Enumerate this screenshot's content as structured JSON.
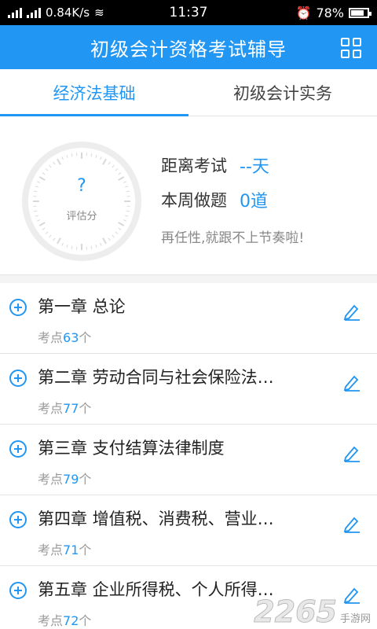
{
  "status_bar": {
    "network_speed": "0.84K/s",
    "time": "11:37",
    "battery": "78%",
    "battery_level": 0.78
  },
  "header": {
    "title": "初级会计资格考试辅导",
    "menu_icon": "grid-icon"
  },
  "tabs": [
    {
      "label": "经济法基础",
      "active": true
    },
    {
      "label": "初级会计实务",
      "active": false
    }
  ],
  "summary": {
    "score_value": "?",
    "score_label": "评估分",
    "countdown_label": "距离考试",
    "countdown_value": "--天",
    "weekly_label": "本周做题",
    "weekly_value": "0道",
    "motto": "再任性,就跟不上节奏啦!"
  },
  "chapters": [
    {
      "title": "第一章 总论",
      "points_prefix": "考点",
      "points": "63",
      "points_suffix": "个"
    },
    {
      "title": "第二章 劳动合同与社会保险法…",
      "points_prefix": "考点",
      "points": "77",
      "points_suffix": "个"
    },
    {
      "title": "第三章 支付结算法律制度",
      "points_prefix": "考点",
      "points": "79",
      "points_suffix": "个"
    },
    {
      "title": "第四章 增值税、消费税、营业…",
      "points_prefix": "考点",
      "points": "71",
      "points_suffix": "个"
    },
    {
      "title": "第五章 企业所得税、个人所得…",
      "points_prefix": "考点",
      "points": "72",
      "points_suffix": "个"
    }
  ],
  "watermark": {
    "logo_text": "2265",
    "site_text": "手游网"
  },
  "colors": {
    "accent": "#2196f3",
    "status_bar": "#000000"
  }
}
